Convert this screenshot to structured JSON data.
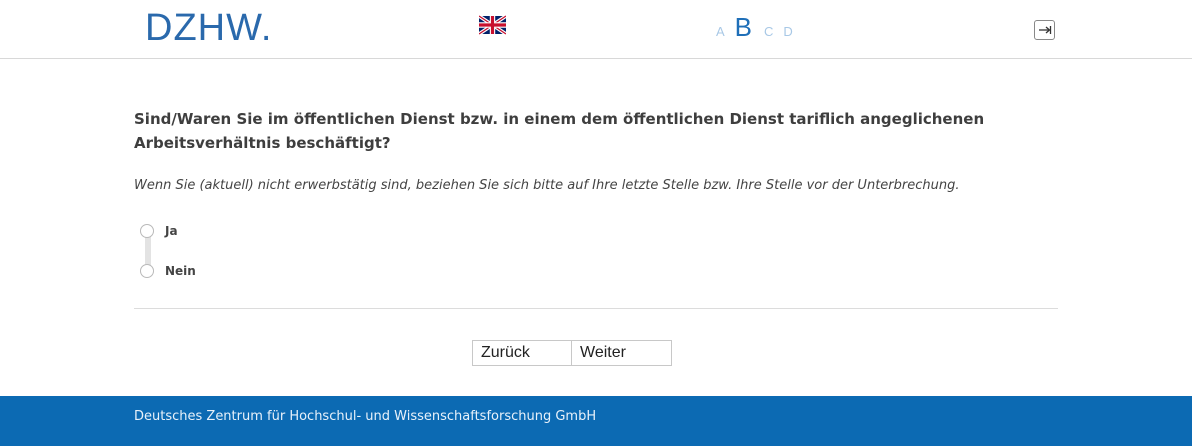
{
  "header": {
    "logo_text": "DZHW.",
    "language_flag": "uk-flag-icon",
    "steps": [
      {
        "label": "A",
        "active": false
      },
      {
        "label": "B",
        "active": true
      },
      {
        "label": "C",
        "active": false
      },
      {
        "label": "D",
        "active": false
      }
    ],
    "logout_icon": "logout-arrow-icon"
  },
  "question": {
    "text": "Sind/Waren Sie im öffentlichen Dienst bzw. in einem dem öffentlichen Dienst tariflich angeglichenen Arbeitsverhältnis beschäftigt?",
    "hint": "Wenn Sie (aktuell) nicht erwerbstätig sind, beziehen Sie sich bitte auf Ihre letzte Stelle bzw. Ihre Stelle vor der Unterbrechung.",
    "options": [
      {
        "label": "Ja",
        "selected": false
      },
      {
        "label": "Nein",
        "selected": false
      }
    ]
  },
  "navigation": {
    "back_label": "Zurück",
    "next_label": "Weiter"
  },
  "footer": {
    "text": "Deutsches Zentrum für Hochschul- und Wissenschaftsforschung GmbH"
  },
  "colors": {
    "brand": "#2a69ac",
    "footer_bg": "#0c6ab3",
    "step_active": "#1f6fb8",
    "step_inactive": "#a8c8e6"
  }
}
